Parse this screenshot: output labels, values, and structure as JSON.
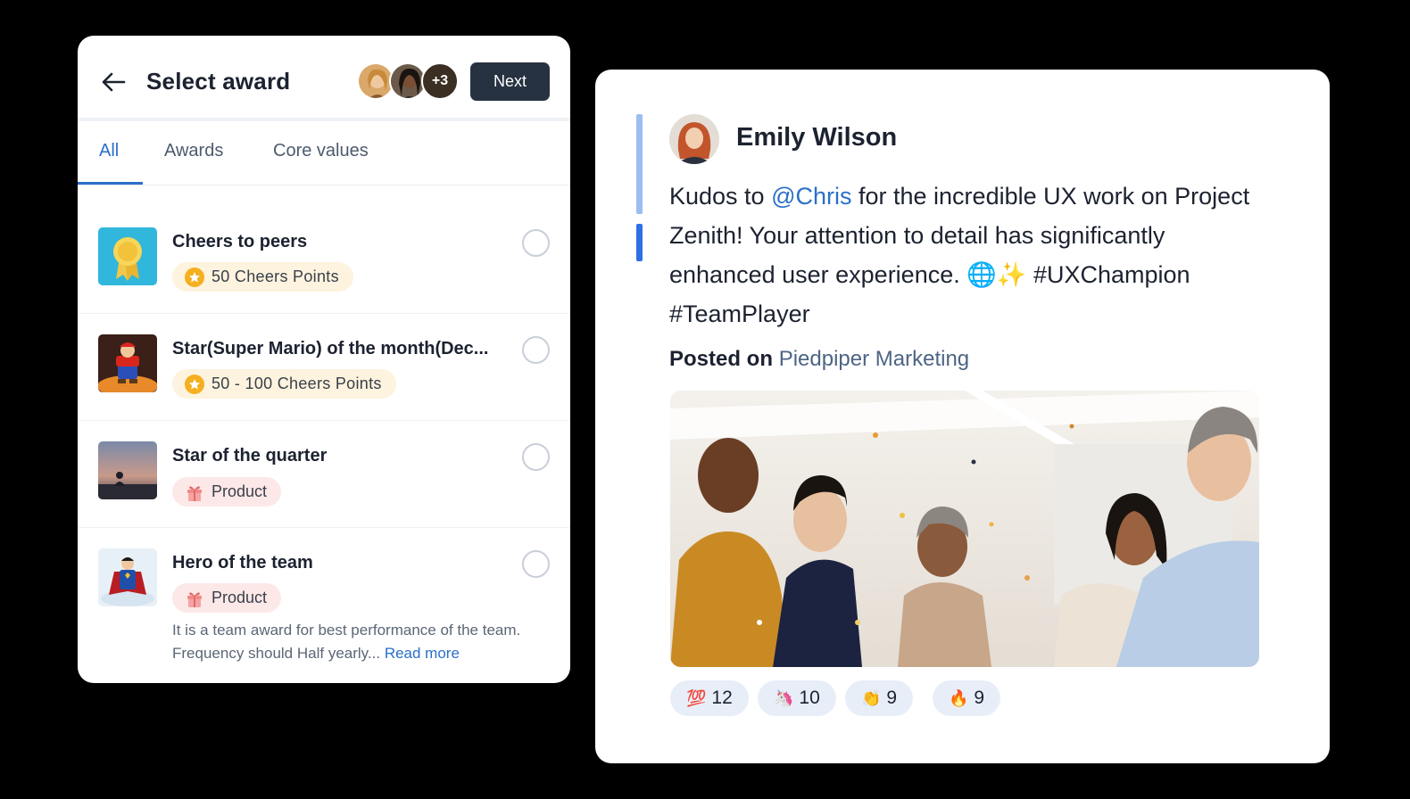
{
  "award_panel": {
    "title": "Select award",
    "avatars_more": "+3",
    "next_label": "Next",
    "tabs": [
      {
        "label": "All",
        "active": true
      },
      {
        "label": "Awards",
        "active": false
      },
      {
        "label": "Core values",
        "active": false
      }
    ],
    "items": [
      {
        "name": "Cheers to peers",
        "badge_type": "points",
        "badge": "50 Cheers Points",
        "icon": "ribbon-medal-icon"
      },
      {
        "name": "Star(Super Mario) of the month(Dec...",
        "badge_type": "points",
        "badge": "50 - 100 Cheers Points",
        "icon": "mario-figure-icon"
      },
      {
        "name": "Star of the quarter",
        "badge_type": "category",
        "badge": "Product",
        "icon": "sunset-person-icon"
      },
      {
        "name": "Hero of the team",
        "badge_type": "category",
        "badge": "Product",
        "icon": "superhero-figure-icon",
        "description": "It is a team award for best performance of the team. Frequency should Half yearly...",
        "read_more": "Read more"
      }
    ]
  },
  "post": {
    "author": "Emily Wilson",
    "text_before": "Kudos to ",
    "mention": "@Chris",
    "text_after": " for the incredible UX work on Project Zenith! Your attention to detail has significantly enhanced user experience. 🌐✨ #UXChampion #TeamPlayer",
    "posted_on_label": "Posted on",
    "posted_on_channel": "Piedpiper Marketing",
    "reactions": [
      {
        "emoji": "💯",
        "count": "12"
      },
      {
        "emoji": "🦄",
        "count": "10"
      },
      {
        "emoji": "👏",
        "count": "9"
      },
      {
        "emoji": "🔥",
        "count": "9"
      }
    ]
  },
  "colors": {
    "accent_blue": "#2a6fc9",
    "button_dark": "#263241",
    "points_badge_bg": "#fdf3de",
    "product_badge_bg": "#fde8e8",
    "reaction_bg": "#e8eef8"
  }
}
